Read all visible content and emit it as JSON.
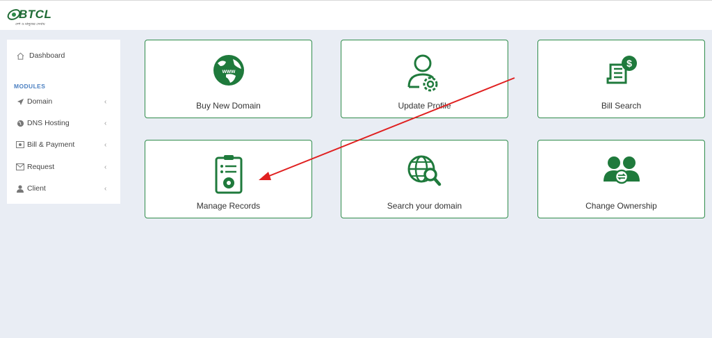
{
  "header": {
    "logo_text": "BTCL",
    "logo_tagline": "দেশ ও মানুষের সেবায়"
  },
  "sidebar": {
    "dashboard": {
      "label": "Dashboard",
      "icon": "home-icon"
    },
    "section_label": "MODULES",
    "items": [
      {
        "label": "Domain",
        "icon": "paper-plane-icon"
      },
      {
        "label": "DNS Hosting",
        "icon": "globe-icon"
      },
      {
        "label": "Bill & Payment",
        "icon": "bill-icon"
      },
      {
        "label": "Request",
        "icon": "envelope-icon"
      },
      {
        "label": "Client",
        "icon": "user-icon"
      }
    ]
  },
  "cards": [
    {
      "label": "Buy New Domain",
      "icon": "www-globe-icon"
    },
    {
      "label": "Update Profile",
      "icon": "user-gear-icon"
    },
    {
      "label": "Bill Search",
      "icon": "bill-dollar-icon"
    },
    {
      "label": "Manage Records",
      "icon": "clipboard-gear-icon"
    },
    {
      "label": "Search your domain",
      "icon": "globe-search-icon"
    },
    {
      "label": "Change Ownership",
      "icon": "users-exchange-icon"
    }
  ],
  "colors": {
    "brand_green": "#1f7a3c",
    "annotation_arrow": "#e02020",
    "background": "#e9edf4"
  }
}
